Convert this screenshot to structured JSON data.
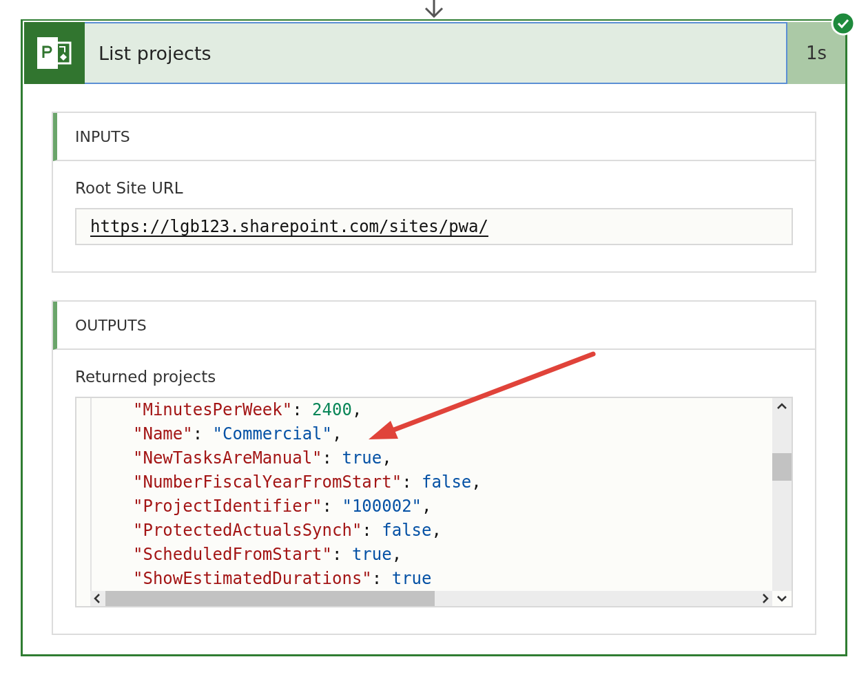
{
  "action": {
    "title": "List projects",
    "duration": "1s",
    "succeeded": true
  },
  "inputs": {
    "heading": "INPUTS",
    "fields": [
      {
        "label": "Root Site URL",
        "value": "https://lgb123.sharepoint.com/sites/pwa/"
      }
    ]
  },
  "outputs": {
    "heading": "OUTPUTS",
    "label": "Returned projects",
    "code_lines": [
      [
        {
          "text": "\"MinutesPerWeek\"",
          "kind": "key"
        },
        {
          "text": ": ",
          "kind": "punct"
        },
        {
          "text": "2400",
          "kind": "number"
        },
        {
          "text": ",",
          "kind": "punct"
        }
      ],
      [
        {
          "text": "\"Name\"",
          "kind": "key"
        },
        {
          "text": ": ",
          "kind": "punct"
        },
        {
          "text": "\"Commercial\"",
          "kind": "string"
        },
        {
          "text": ",",
          "kind": "punct"
        }
      ],
      [
        {
          "text": "\"NewTasksAreManual\"",
          "kind": "key"
        },
        {
          "text": ": ",
          "kind": "punct"
        },
        {
          "text": "true",
          "kind": "boolean"
        },
        {
          "text": ",",
          "kind": "punct"
        }
      ],
      [
        {
          "text": "\"NumberFiscalYearFromStart\"",
          "kind": "key"
        },
        {
          "text": ": ",
          "kind": "punct"
        },
        {
          "text": "false",
          "kind": "boolean"
        },
        {
          "text": ",",
          "kind": "punct"
        }
      ],
      [
        {
          "text": "\"ProjectIdentifier\"",
          "kind": "key"
        },
        {
          "text": ": ",
          "kind": "punct"
        },
        {
          "text": "\"100002\"",
          "kind": "string"
        },
        {
          "text": ",",
          "kind": "punct"
        }
      ],
      [
        {
          "text": "\"ProtectedActualsSynch\"",
          "kind": "key"
        },
        {
          "text": ": ",
          "kind": "punct"
        },
        {
          "text": "false",
          "kind": "boolean"
        },
        {
          "text": ",",
          "kind": "punct"
        }
      ],
      [
        {
          "text": "\"ScheduledFromStart\"",
          "kind": "key"
        },
        {
          "text": ": ",
          "kind": "punct"
        },
        {
          "text": "true",
          "kind": "boolean"
        },
        {
          "text": ",",
          "kind": "punct"
        }
      ],
      [
        {
          "text": "\"ShowEstimatedDurations\"",
          "kind": "key"
        },
        {
          "text": ": ",
          "kind": "punct"
        },
        {
          "text": "true",
          "kind": "boolean"
        }
      ]
    ]
  }
}
